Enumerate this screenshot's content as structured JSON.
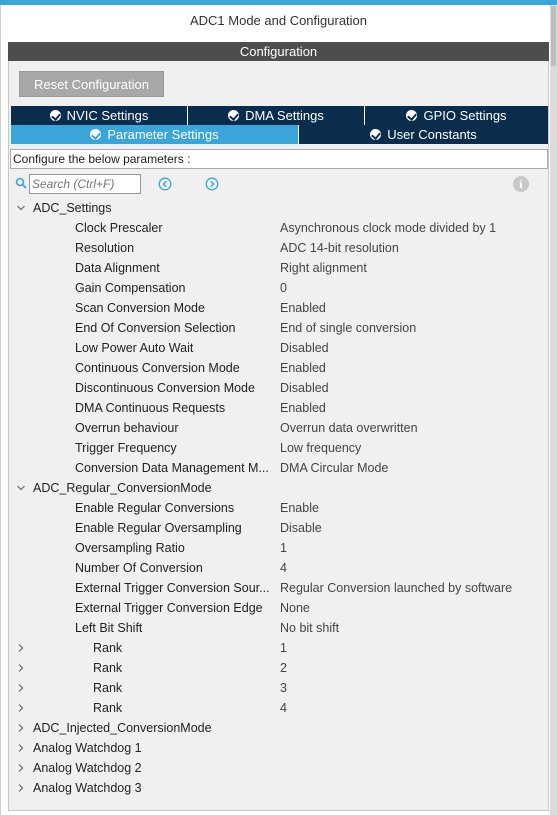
{
  "window": {
    "title": "ADC1 Mode and Configuration"
  },
  "config_header": "Configuration",
  "reset_button": "Reset Configuration",
  "tabs_row1": [
    {
      "label": "NVIC Settings"
    },
    {
      "label": "DMA Settings"
    },
    {
      "label": "GPIO Settings"
    }
  ],
  "tabs_row2": [
    {
      "label": "Parameter Settings",
      "active": true
    },
    {
      "label": "User Constants",
      "active": false
    }
  ],
  "description": "Configure the below parameters :",
  "search": {
    "placeholder": "Search (Ctrl+F)"
  },
  "info_icon": "i",
  "groups": [
    {
      "name": "ADC_Settings",
      "expanded": true,
      "params": [
        {
          "label": "Clock Prescaler",
          "value": "Asynchronous clock mode divided by 1"
        },
        {
          "label": "Resolution",
          "value": "ADC 14-bit resolution"
        },
        {
          "label": "Data Alignment",
          "value": "Right alignment"
        },
        {
          "label": "Gain Compensation",
          "value": "0"
        },
        {
          "label": "Scan Conversion Mode",
          "value": "Enabled"
        },
        {
          "label": "End Of Conversion Selection",
          "value": "End of single conversion"
        },
        {
          "label": "Low Power Auto Wait",
          "value": "Disabled"
        },
        {
          "label": "Continuous Conversion Mode",
          "value": "Enabled"
        },
        {
          "label": "Discontinuous Conversion Mode",
          "value": "Disabled"
        },
        {
          "label": "DMA Continuous Requests",
          "value": "Enabled"
        },
        {
          "label": "Overrun behaviour",
          "value": "Overrun data overwritten"
        },
        {
          "label": "Trigger Frequency",
          "value": "Low frequency"
        },
        {
          "label": "Conversion Data Management M...",
          "value": "DMA Circular Mode"
        }
      ]
    },
    {
      "name": "ADC_Regular_ConversionMode",
      "expanded": true,
      "params": [
        {
          "label": "Enable Regular Conversions",
          "value": "Enable"
        },
        {
          "label": "Enable Regular Oversampling",
          "value": "Disable"
        },
        {
          "label": "Oversampling Ratio",
          "value": "1"
        },
        {
          "label": "Number Of Conversion",
          "value": "4"
        },
        {
          "label": "External Trigger Conversion Sour...",
          "value": "Regular Conversion launched by software"
        },
        {
          "label": "External Trigger Conversion Edge",
          "value": "None"
        },
        {
          "label": "Left Bit Shift",
          "value": "No bit shift"
        }
      ],
      "ranks": [
        {
          "label": "Rank",
          "value": "1"
        },
        {
          "label": "Rank",
          "value": "2"
        },
        {
          "label": "Rank",
          "value": "3"
        },
        {
          "label": "Rank",
          "value": "4"
        }
      ]
    },
    {
      "name": "ADC_Injected_ConversionMode",
      "expanded": false
    },
    {
      "name": "Analog Watchdog 1",
      "expanded": false
    },
    {
      "name": "Analog Watchdog 2",
      "expanded": false
    },
    {
      "name": "Analog Watchdog 3",
      "expanded": false
    }
  ],
  "colors": {
    "accent": "#3aa5d8",
    "tab_dark": "#0a2d4d",
    "header_bg": "#4d4d4d",
    "reset_bg": "#a8a8a8"
  }
}
